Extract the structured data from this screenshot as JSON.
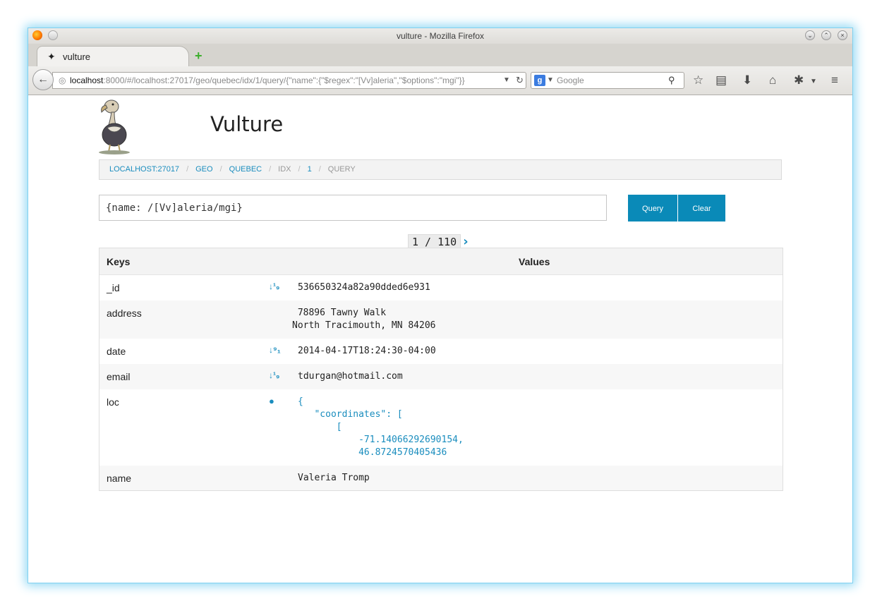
{
  "window": {
    "title": "vulture - Mozilla Firefox"
  },
  "tab": {
    "title": "vulture",
    "new_tab": "+"
  },
  "urlbar": {
    "host": "localhost",
    "rest": ":8000/#/localhost:27017/geo/quebec/idx/1/query/{\"name\":{\"$regex\":\"[Vv]aleria\",\"$options\":\"mgi\"}}"
  },
  "searchbar": {
    "engine_logo": "g",
    "placeholder": "Google"
  },
  "icons": {
    "back": "back-arrow-icon",
    "bookmark": "star-icon",
    "reading": "clipboard-icon",
    "download": "download-icon",
    "home": "home-icon",
    "extension": "extension-icon",
    "menu": "hamburger-menu-icon"
  },
  "app": {
    "title": "Vulture"
  },
  "breadcrumb": [
    "localhost:27017",
    "geo",
    "quebec",
    "idx",
    "1",
    "query"
  ],
  "query": {
    "value": "{name: /[Vv]aleria/mgi}"
  },
  "buttons": {
    "query": "Query",
    "clear": "Clear"
  },
  "pager": {
    "label": "1 / 110",
    "next": "›"
  },
  "table": {
    "headers": {
      "keys": "Keys",
      "values": "Values"
    },
    "rows": [
      {
        "key": "_id",
        "icon": "sort-numeric-icon",
        "value": "536650324a82a90dded6e931"
      },
      {
        "key": "address",
        "icon": "",
        "value": " 78896 Tawny Walk\nNorth Tracimouth, MN 84206"
      },
      {
        "key": "date",
        "icon": "sort-numeric-desc-icon",
        "value": "2014-04-17T18:24:30-04:00"
      },
      {
        "key": "email",
        "icon": "sort-numeric-icon",
        "value": "tdurgan@hotmail.com"
      },
      {
        "key": "loc",
        "icon": "globe-icon",
        "value": "{\n   \"coordinates\": [\n       [\n           -71.14066292690154,\n           46.8724570405436"
      },
      {
        "key": "name",
        "icon": "",
        "value": "Valeria Tromp"
      }
    ]
  }
}
